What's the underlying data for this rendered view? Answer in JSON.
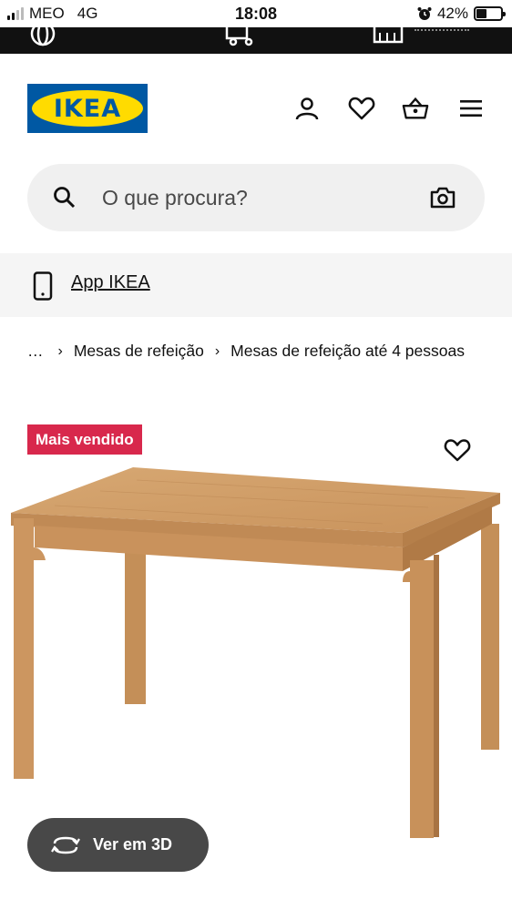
{
  "status_bar": {
    "carrier": "MEO",
    "network": "4G",
    "time": "18:08",
    "battery": "42%",
    "battery_level": 0.42
  },
  "header": {
    "logo_text": "IKEA",
    "brand_colors": {
      "blue": "#0058a3",
      "yellow": "#ffdb00"
    },
    "icons": [
      "user-icon",
      "heart-icon",
      "basket-icon",
      "menu-icon"
    ]
  },
  "search": {
    "placeholder": "O que procura?"
  },
  "app_banner": {
    "label": "App IKEA"
  },
  "breadcrumb": {
    "items": [
      "…",
      "Mesas de refeição",
      "Mesas de refeição até 4 pessoas"
    ]
  },
  "product": {
    "badge": "Mais vendido",
    "badge_color": "#d8284c"
  },
  "view_3d": {
    "label": "Ver em 3D"
  }
}
